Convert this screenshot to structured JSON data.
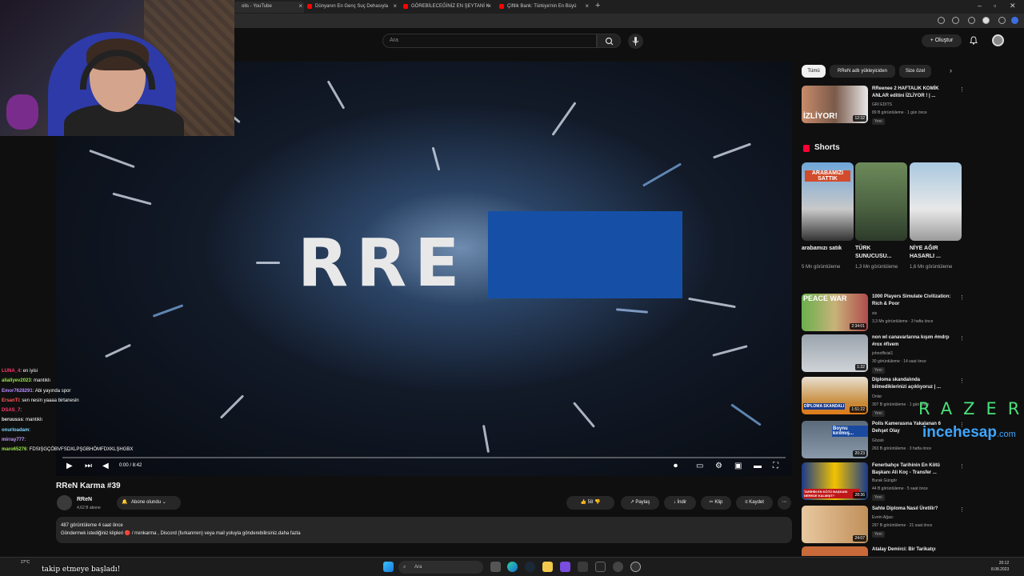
{
  "browser": {
    "tabs": [
      {
        "title": "olis - YouTube"
      },
      {
        "title": "Dünyanın En Genç Suç Dehasıyla"
      },
      {
        "title": "GÖREBİLECEĞİNİZ EN ŞEYTANİ K"
      },
      {
        "title": "Çiftlik Bank: Türkiye'nin En Büyü"
      }
    ]
  },
  "youtube": {
    "search_placeholder": "Ara",
    "create_label": "Oluştur"
  },
  "video": {
    "overlay_text": "RRE",
    "time": "0:00 / 8:42",
    "title": "RReN Karma #39"
  },
  "channel": {
    "name": "RReN",
    "subs": "4,62 B abone",
    "subscribe_label": "Abone olundu"
  },
  "actions": {
    "likes": "58",
    "share": "Paylaş",
    "download": "İndir",
    "clip": "Klip",
    "save": "Kaydet"
  },
  "description": {
    "stats": "487 görüntüleme  4 saat önce",
    "text": "Göndermek istediğiniz klipleri 🔴 / rrenkarma , Discord (furkanrren) veya mail yoluyla gönderebilirsiniz.daha fazla"
  },
  "chat": [
    {
      "user": "LUNA_4",
      "msg": ": en iyisi",
      "color": "#ff3b6b"
    },
    {
      "user": "aliallyev2023",
      "msg": ": mantıklı",
      "color": "#9be64b"
    },
    {
      "user": "Emor7628291",
      "msg": ": Abi yayında spor",
      "color": "#b48cff"
    },
    {
      "user": "ErsanTi",
      "msg": ": sen nesin yaaaa birtanesin",
      "color": "#ff5a5a"
    },
    {
      "user": "DSAS_7",
      "msg": ":",
      "color": "#ff3b6b"
    },
    {
      "user": "beruusss",
      "msg": ": mantıklı",
      "color": "#e0e0e0"
    },
    {
      "user": "onurloadam",
      "msg": ":",
      "color": "#7fd4ff"
    },
    {
      "user": "mirray777",
      "msg": ":",
      "color": "#c59bff"
    },
    {
      "user": "maro65276",
      "msg": ": FDSIŞGÇÖBVFSDXLPŞGBHÖMFDXKLŞHGBX",
      "color": "#9be64b"
    }
  ],
  "sidebar": {
    "chips": [
      "Tümü",
      "RReN adlı yükleyiciden",
      "Size özel"
    ],
    "first_rec": {
      "title": "RReenee 2 HAFTALIK KOMİK ANLAR editini İZLİYOR ! | ...",
      "channel": "GRI EDITS",
      "meta": "89 B görüntüleme · 1 gün önce",
      "badge": "Yeni",
      "duration": "12:32",
      "thumb_text": "İZLİYOR!"
    },
    "shorts_title": "Shorts",
    "shorts": [
      {
        "title": "arabamızı satık",
        "views": "5 Mn görüntüleme",
        "thumb_text": "ARABAMIZI SATTIK"
      },
      {
        "title": "TÜRK SUNUCUSU...",
        "views": "1,3 Mn görüntüleme",
        "thumb_text": ""
      },
      {
        "title": "NİYE AĞIR HASARLI ...",
        "views": "1,6 Mn görüntüleme",
        "thumb_text": ""
      }
    ],
    "recs": [
      {
        "title": "1000 Players Simulate Civilization: Rich & Poor",
        "channel": "sis",
        "meta": "3,3 Mn görüntüleme · 3 hafta önce",
        "badge": "",
        "duration": "2:34:01",
        "thumb_text": "PEACE WAR"
      },
      {
        "title": "non wl canavarlarına kışım #mdrp #rox #fivem",
        "channel": "johnofficial1",
        "meta": "30 görüntüleme · 14 saat önce",
        "badge": "Yeni",
        "duration": "1:32",
        "thumb_text": ""
      },
      {
        "title": "Diploma skandalında bilmediklerinizi açıklıyoruz | ...",
        "channel": "Onlar",
        "meta": "307 B görüntüleme · 1 gün önce",
        "badge": "Yeni",
        "duration": "1:51:22",
        "thumb_text": "DİPLOMA SKANDALI"
      },
      {
        "title": "Polis Kamerasına Yakalanan 6 Dehşet Olay",
        "channel": "Gözatı",
        "meta": "263 B görüntüleme · 3 hafta önce",
        "badge": "",
        "duration": "20:23",
        "thumb_text": "Boynu kırılmış..."
      },
      {
        "title": "Fenerbahçe Tarihinin En Kötü Başkanı Ali Koç - Transfer ...",
        "channel": "Burak Güngör",
        "meta": "44 B görüntüleme · 5 saat önce",
        "badge": "Yeni",
        "duration": "28:36",
        "thumb_text": "TARİHİN EN KÖTÜ BAŞKANI NEREDE KALMIŞT?"
      },
      {
        "title": "Sahte Diploma Nasıl Üretilir?",
        "channel": "Evrim Ağacı",
        "meta": "297 B görüntüleme · 21 saat önce",
        "badge": "Yeni",
        "duration": "24:07",
        "thumb_text": ""
      },
      {
        "title": "Atalay Demirci: Bir Tarikatçı",
        "channel": "",
        "meta": "",
        "badge": "",
        "duration": "",
        "thumb_text": ""
      }
    ]
  },
  "overlay": {
    "razer": "RAZER",
    "ince": "incehesap",
    "com": ".com",
    "follow": "takip etmeye başladı!"
  },
  "taskbar": {
    "search": "Ara",
    "weather": "27°C",
    "time": "20:12",
    "date": "8.08.2023"
  }
}
